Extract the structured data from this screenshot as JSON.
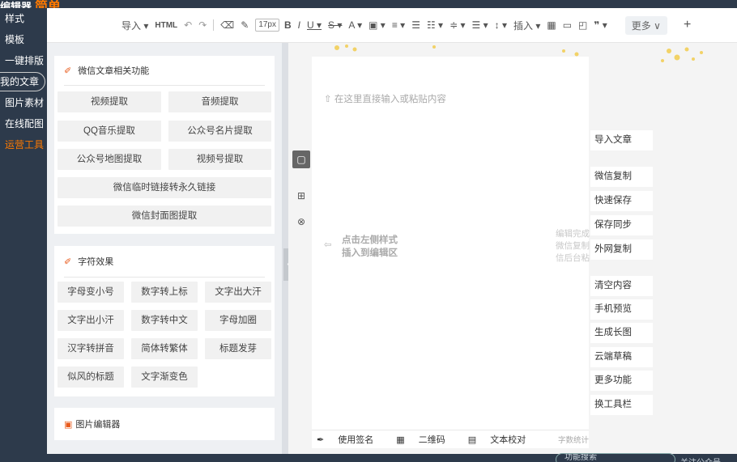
{
  "app": {
    "logo_text": "编辑器",
    "logo_accent": "简单"
  },
  "leftnav": {
    "items": [
      {
        "label": "样式",
        "active": false
      },
      {
        "label": "模板",
        "active": false
      },
      {
        "label": "一键排版",
        "active": false
      },
      {
        "label": "我的文章",
        "active": false
      },
      {
        "label": "图片素材",
        "active": false
      },
      {
        "label": "在线配图",
        "active": false
      },
      {
        "label": "运营工具",
        "active": true
      }
    ]
  },
  "toolbar": {
    "import_label": "导入",
    "html_label": "HTML",
    "font_size": "17px",
    "insert_label": "插入",
    "more_label": "更多",
    "more_chevron": "∨",
    "plus": "+"
  },
  "wechat_card": {
    "title": "微信文章相关功能",
    "buttons": [
      "视频提取",
      "音频提取",
      "QQ音乐提取",
      "公众号名片提取",
      "公众号地图提取",
      "视频号提取",
      "微信临时链接转永久链接",
      "微信封面图提取"
    ]
  },
  "char_card": {
    "title": "字符效果",
    "buttons": [
      "字母变小号",
      "数字转上标",
      "文字出大汗",
      "文字出小汗",
      "数字转中文",
      "字母加圈",
      "汉字转拼音",
      "简体转繁体",
      "标题发芽",
      "似风的标题",
      "文字渐变色"
    ]
  },
  "image_card": {
    "title": "图片编辑器"
  },
  "editor": {
    "placeholder": "在这里直接输入或粘贴内容",
    "hint_line1": "点击左侧样式",
    "hint_line2": "插入到编辑区",
    "right_hint": [
      "编辑完成",
      "微信复制",
      "信后台粘"
    ],
    "footer": {
      "signature": "使用签名",
      "qrcode": "二维码",
      "proofread": "文本校对",
      "count": "字数统计"
    }
  },
  "actions": [
    "导入文章",
    "微信复制",
    "快速保存",
    "保存同步",
    "外网复制",
    "清空内容",
    "手机预览",
    "生成长图",
    "云端草稿",
    "更多功能",
    "换工具栏"
  ],
  "bottom": {
    "search_placeholder": "功能搜索",
    "right_text": "关注公众号"
  },
  "colors": {
    "nav_bg": "#2d3a4b",
    "accent": "#ff7a00",
    "pen_icon": "#e85a1b"
  }
}
